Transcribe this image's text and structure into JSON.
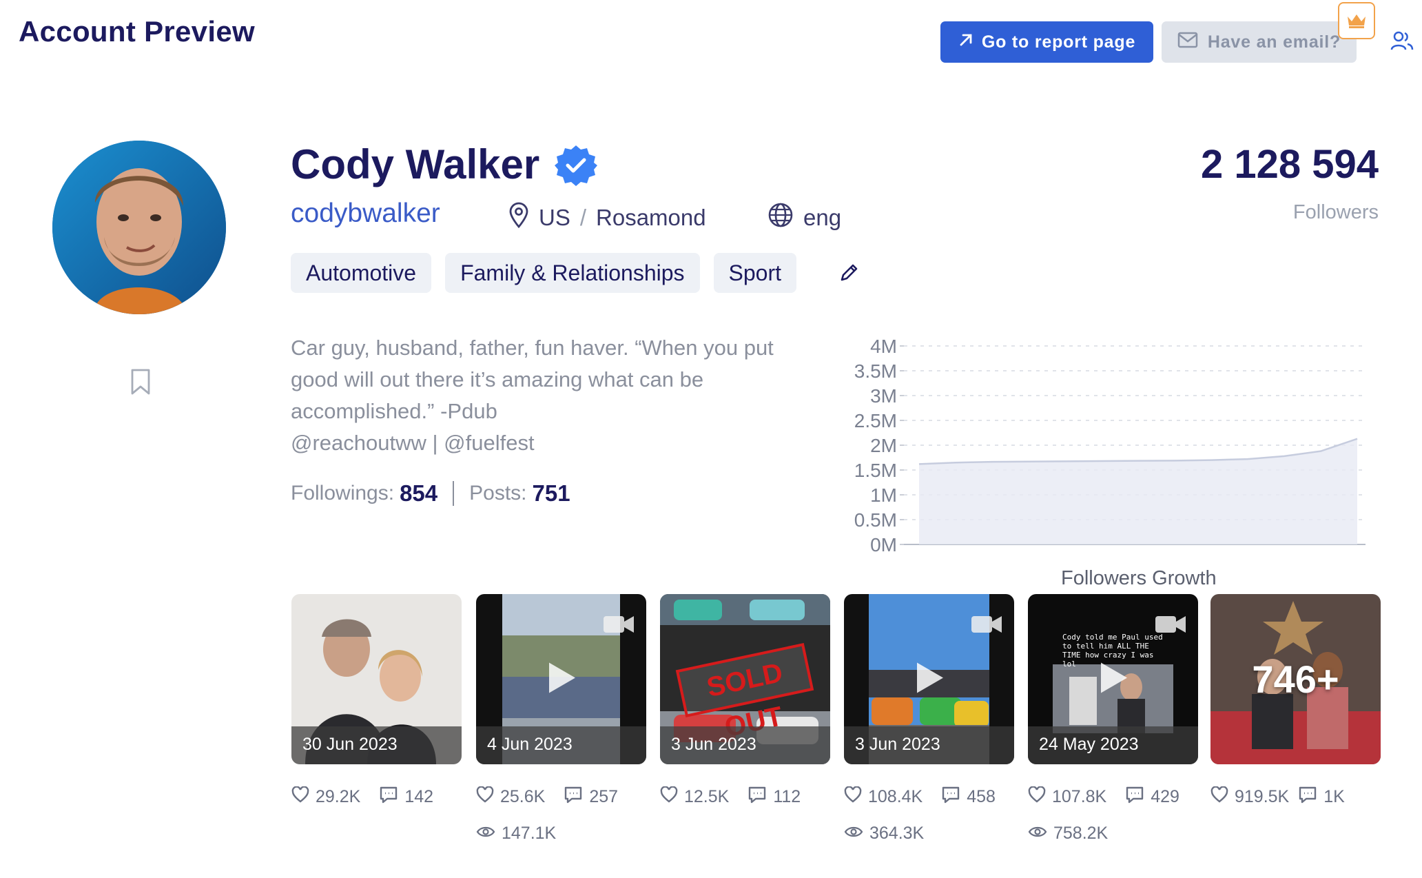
{
  "header": {
    "title": "Account Preview",
    "report_button": "Go to report page",
    "email_button": "Have an email?"
  },
  "profile": {
    "name": "Cody Walker",
    "handle": "codybwalker",
    "location_country": "US",
    "location_city": "Rosamond",
    "language": "eng",
    "tags": [
      "Automotive",
      "Family & Relationships",
      "Sport"
    ],
    "followers_count": "2 128 594",
    "followers_label": "Followers",
    "bio_lines": [
      "Car guy, husband, father, fun haver. “When you put",
      "good will out there it’s amazing what can be",
      "accomplished.” -Pdub",
      "@reachoutww | @fuelfest"
    ],
    "followings_label": "Followings:",
    "followings_value": "854",
    "posts_label": "Posts:",
    "posts_value": "751"
  },
  "chart_data": {
    "type": "area",
    "title": "Followers Growth",
    "y_ticks": [
      "4M",
      "3.5M",
      "3M",
      "2.5M",
      "2M",
      "1.5M",
      "1M",
      "0.5M",
      "0M"
    ],
    "ylim": [
      0,
      4000000
    ],
    "grid": true,
    "series": [
      {
        "values": [
          1620000,
          1650000,
          1665000,
          1670000,
          1675000,
          1680000,
          1685000,
          1690000,
          1700000,
          1720000,
          1780000,
          1880000,
          2128594
        ]
      }
    ]
  },
  "posts": [
    {
      "date": "30 Jun 2023",
      "likes": "29.2K",
      "comments": "142",
      "video": false
    },
    {
      "date": "4 Jun 2023",
      "likes": "25.6K",
      "comments": "257",
      "views": "147.1K",
      "video": true
    },
    {
      "date": "3 Jun 2023",
      "likes": "12.5K",
      "comments": "112",
      "video": false,
      "overlay_text": "SOLD OUT"
    },
    {
      "date": "3 Jun 2023",
      "likes": "108.4K",
      "comments": "458",
      "views": "364.3K",
      "video": true
    },
    {
      "date": "24 May 2023",
      "likes": "107.8K",
      "comments": "429",
      "views": "758.2K",
      "video": true,
      "caption": "Cody told me Paul used to tell him ALL THE TIME how crazy I was lol"
    },
    {
      "more": "746+",
      "likes": "919.5K",
      "comments": "1K"
    }
  ],
  "colors": {
    "primary": "#2f5fd6",
    "navy": "#1c1a5e",
    "muted": "#8a8f9c",
    "crown": "#f2a24a"
  }
}
